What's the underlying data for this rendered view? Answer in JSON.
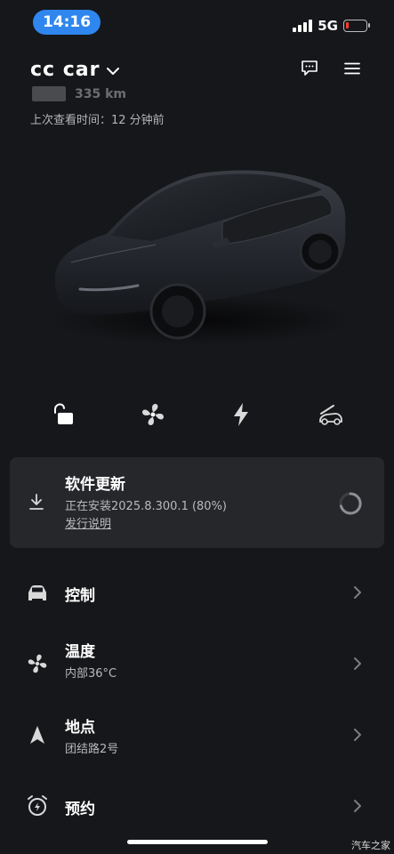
{
  "status_bar": {
    "time": "14:16",
    "network": "5G"
  },
  "header": {
    "car_name": "cc  car",
    "range": "335 km",
    "last_seen": "上次查看时间：12 分钟前",
    "icons": [
      "message-icon",
      "menu-icon"
    ]
  },
  "quick_actions": [
    {
      "name": "lock",
      "icon": "unlock-icon"
    },
    {
      "name": "climate",
      "icon": "fan-icon"
    },
    {
      "name": "charge",
      "icon": "bolt-icon"
    },
    {
      "name": "frunk",
      "icon": "frunk-icon"
    }
  ],
  "software_update": {
    "title": "软件更新",
    "status": "正在安装2025.8.300.1 (80%)",
    "progress": 0.8,
    "notes_link": "发行说明"
  },
  "menu": [
    {
      "title": "控制",
      "subtitle": "",
      "icon": "car-icon"
    },
    {
      "title": "温度",
      "subtitle": "内部36°C",
      "icon": "fan-icon"
    },
    {
      "title": "地点",
      "subtitle": "团结路2号",
      "icon": "navigation-icon"
    },
    {
      "title": "预约",
      "subtitle": "",
      "icon": "alarm-icon"
    }
  ],
  "watermark": "汽车之家",
  "colors": {
    "accent": "#2f86ee",
    "background": "#16171a",
    "card": "#26272b",
    "battery_low": "#ff3b30"
  }
}
